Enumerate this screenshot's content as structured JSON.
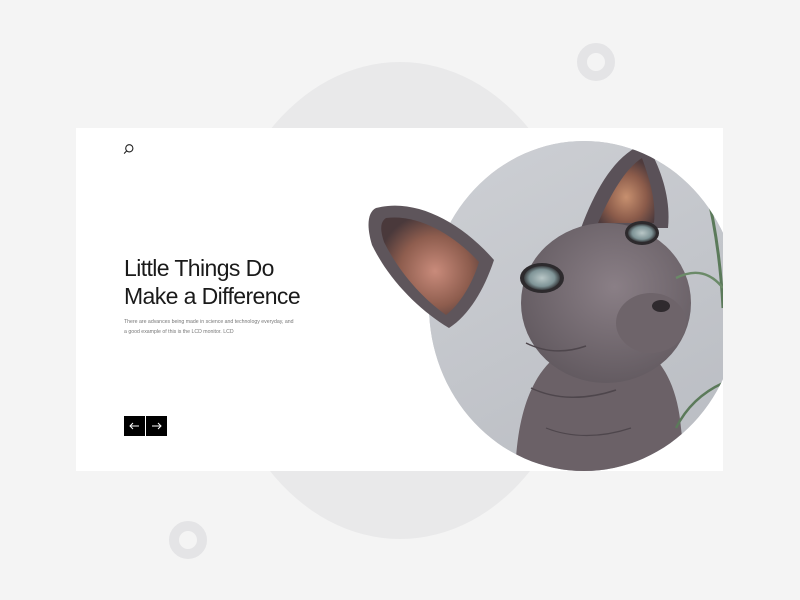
{
  "hero": {
    "headline_line1": "Little Things Do",
    "headline_line2": "Make a Difference",
    "description": "There are advances being made in science and technology everyday, and a good example of this is the LCD monitor. LCD"
  },
  "icons": {
    "search": "search-icon",
    "prev": "arrow-left-icon",
    "next": "arrow-right-icon"
  },
  "colors": {
    "background": "#f4f4f4",
    "card": "#ffffff",
    "text": "#1a1a1a",
    "button": "#000000",
    "decor_circle": "#e9e9ea"
  }
}
